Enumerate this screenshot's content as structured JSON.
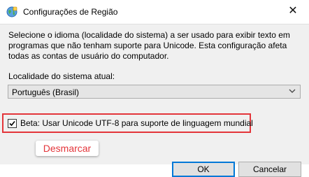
{
  "window": {
    "title": "Configurações de Região",
    "close_glyph": "✕",
    "icon": "globe-icon"
  },
  "content": {
    "description": "Selecione o idioma (localidade do sistema) a ser usado para exibir texto em programas que não tenham suporte para Unicode. Esta configuração afeta todas as contas de usuário do computador.",
    "locale_label": "Localidade do sistema atual:",
    "locale_value": "Português (Brasil)",
    "beta_checked": true,
    "beta_label": "Beta: Usar Unicode UTF-8 para suporte de linguagem mundial"
  },
  "annotation": {
    "text": "Desmarcar",
    "color": "#e3353a"
  },
  "buttons": {
    "ok": "OK",
    "cancel": "Cancelar"
  }
}
